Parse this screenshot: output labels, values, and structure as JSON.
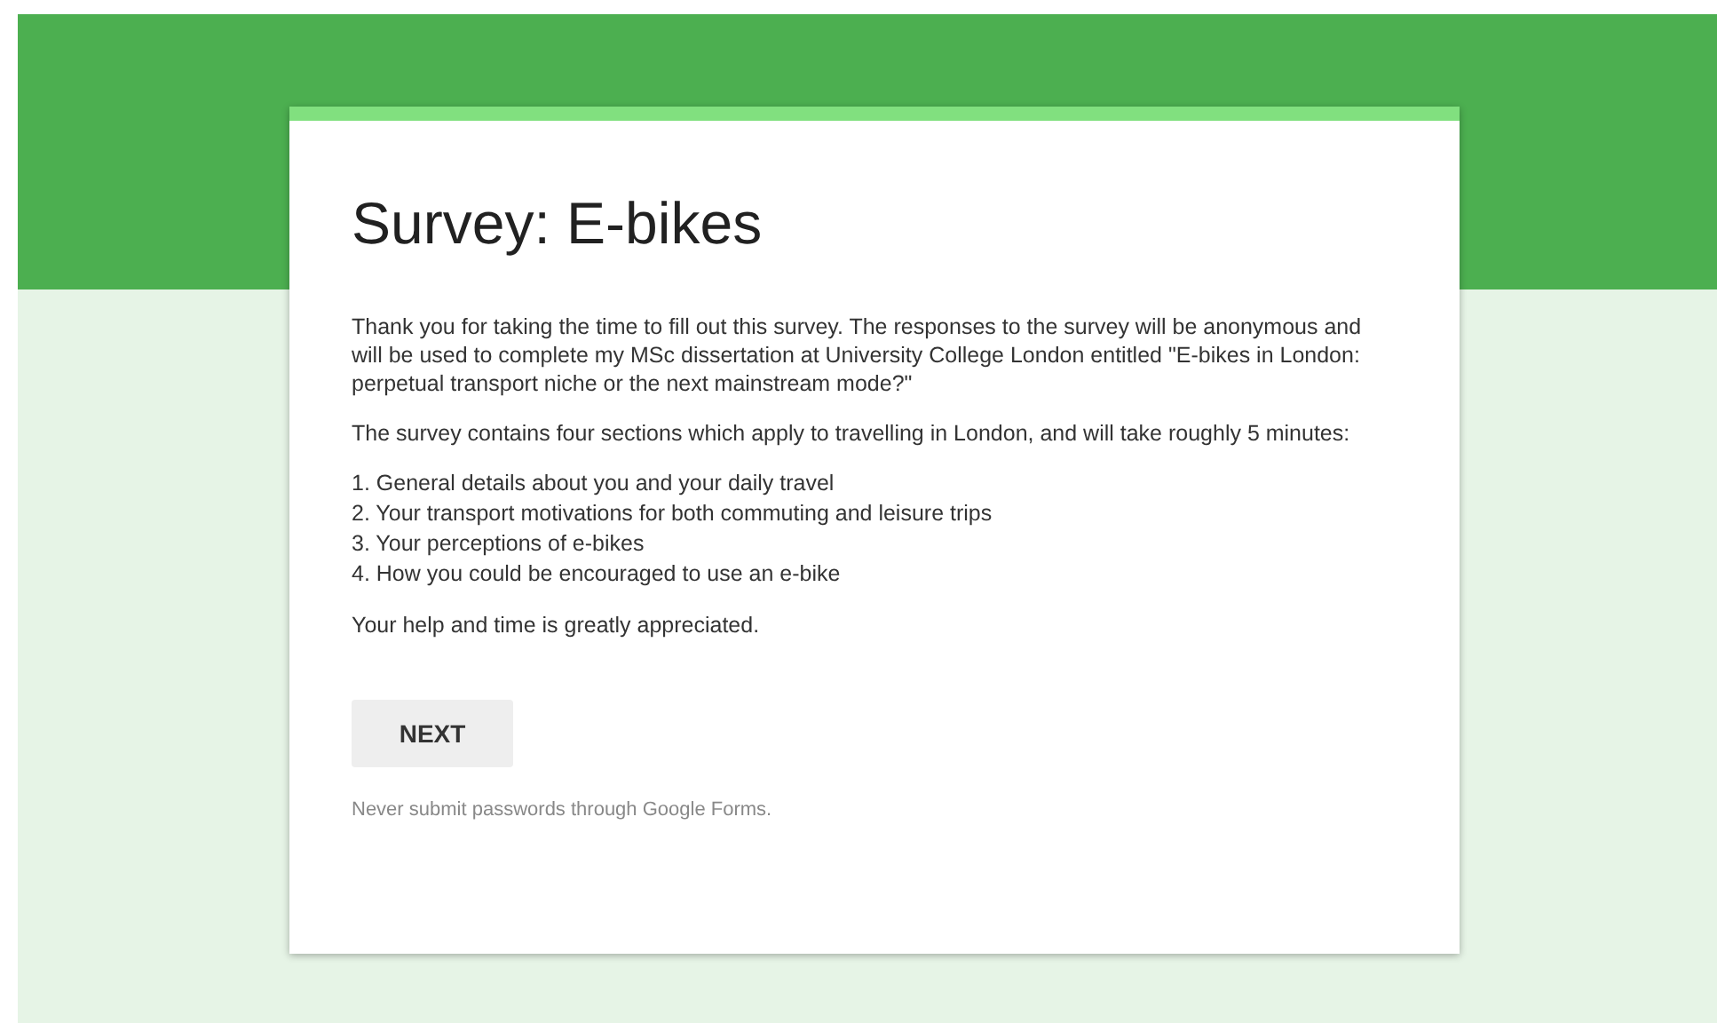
{
  "form": {
    "title": "Survey: E-bikes",
    "paragraphs": [
      "Thank you for taking the time to fill out this survey. The responses to the survey will be anonymous and will be used to complete my MSc dissertation at University College London entitled \"E-bikes in London: perpetual transport niche or the next mainstream mode?\"",
      "The survey contains four sections which apply to travelling in London, and will take roughly 5 minutes:"
    ],
    "list": [
      "1. General details about you and your daily travel",
      "2. Your transport motivations for both commuting and leisure trips",
      "3. Your perceptions of e-bikes",
      "4. How you could be encouraged to use an e-bike"
    ],
    "closing": "Your help and time is greatly appreciated.",
    "button": "NEXT",
    "footer": "Never submit passwords through Google Forms."
  }
}
